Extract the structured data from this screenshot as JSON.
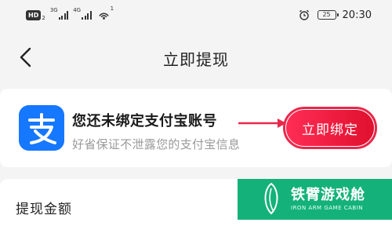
{
  "status_bar": {
    "hd_label": "HD",
    "hd_sub": "2",
    "net1": "3G",
    "net2": "4G",
    "wifi_sup": "1",
    "battery": "25",
    "time": "20:30"
  },
  "nav": {
    "title": "立即提现"
  },
  "bind_card": {
    "title": "您还未绑定支付宝账号",
    "subtitle": "好省保证不泄露您的支付宝信息",
    "button_label": "立即绑定",
    "icon_glyph": "支"
  },
  "withdraw": {
    "label": "提现金额"
  },
  "watermark": {
    "title": "铁臂游戏舱",
    "subtitle": "IRON ARM GAME CABIN"
  },
  "colors": {
    "alipay_blue": "#1677ff",
    "button_red": "#ff2d55",
    "arrow_red": "#e8284a",
    "watermark_green": "#14b27a"
  }
}
